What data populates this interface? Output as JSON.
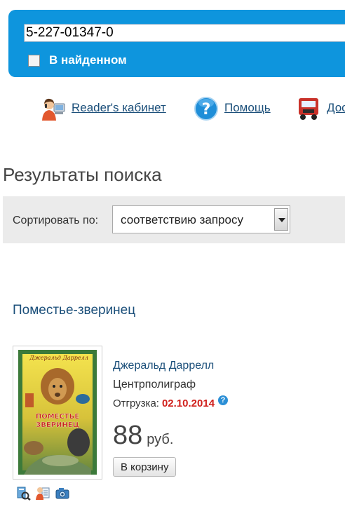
{
  "search": {
    "query": "5-227-01347-0",
    "scope_label": "В найденном"
  },
  "links": {
    "cabinet": "Reader's кабинет",
    "help": "Помощь",
    "delivery": "Дос"
  },
  "results": {
    "title": "Результаты поиска"
  },
  "sort": {
    "label": "Сортировать по:",
    "value": "соответствию запросу"
  },
  "book": {
    "title": "Поместье-зверинец",
    "author": "Джеральд Даррелл",
    "publisher": "Центрполиграф",
    "shipping_label": "Отгрузка:",
    "shipping_date": "02.10.2014",
    "price": "88",
    "currency": "руб.",
    "cart_label": "В корзину",
    "cover_title": "ПОМЕСТЬЕ ЗВЕРИНЕЦ",
    "cover_author": "Джеральд Даррелл"
  },
  "colors": {
    "panel": "#0e95dd",
    "link": "#1b4f7a",
    "date": "#d0201c"
  }
}
